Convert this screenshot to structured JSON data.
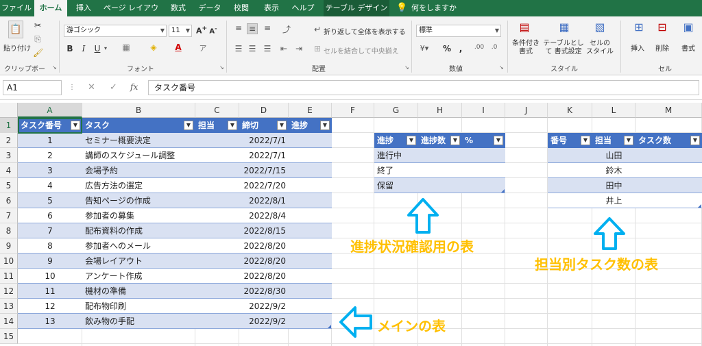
{
  "tabs": [
    "ファイル",
    "ホーム",
    "挿入",
    "ページ レイアウト",
    "数式",
    "データ",
    "校閲",
    "表示",
    "ヘルプ",
    "テーブル デザイン",
    "何をしますか"
  ],
  "ribbon": {
    "clipboard": {
      "paste": "貼り付け",
      "label": "クリップボード"
    },
    "font": {
      "name": "游ゴシック",
      "size": "11",
      "label": "フォント",
      "bold": "B",
      "italic": "I",
      "underline": "U"
    },
    "align": {
      "wrap": "折り返して全体を表示する",
      "merge": "セルを結合して中央揃え",
      "label": "配置"
    },
    "number": {
      "format": "標準",
      "label": "数値",
      "pct": "%",
      "comma": ","
    },
    "styles": {
      "cond": "条件付き 書式",
      "table": "テーブルとして 書式設定",
      "cell": "セルの スタイル",
      "label": "スタイル"
    },
    "cells": {
      "insert": "挿入",
      "delete": "削除",
      "format": "書式",
      "label": "セル"
    }
  },
  "formula_bar": {
    "namebox": "A1",
    "content": "タスク番号",
    "fx": "fx",
    "cancel": "✕",
    "enter": "✓"
  },
  "columns": [
    "A",
    "B",
    "C",
    "D",
    "E",
    "F",
    "G",
    "H",
    "I",
    "J",
    "K",
    "L",
    "M"
  ],
  "rows": [
    "1",
    "2",
    "3",
    "4",
    "5",
    "6",
    "7",
    "8",
    "9",
    "10",
    "11",
    "12",
    "13",
    "14",
    "15"
  ],
  "main_table": {
    "headers": [
      "タスク番号",
      "タスク",
      "担当",
      "締切",
      "進捗"
    ],
    "rows": [
      [
        "1",
        "セミナー概要決定",
        "",
        "2022/7/1",
        ""
      ],
      [
        "2",
        "講師のスケジュール調整",
        "",
        "2022/7/1",
        ""
      ],
      [
        "3",
        "会場予約",
        "",
        "2022/7/15",
        ""
      ],
      [
        "4",
        "広告方法の選定",
        "",
        "2022/7/20",
        ""
      ],
      [
        "5",
        "告知ページの作成",
        "",
        "2022/8/1",
        ""
      ],
      [
        "6",
        "参加者の募集",
        "",
        "2022/8/4",
        ""
      ],
      [
        "7",
        "配布資料の作成",
        "",
        "2022/8/15",
        ""
      ],
      [
        "8",
        "参加者へのメール",
        "",
        "2022/8/20",
        ""
      ],
      [
        "9",
        "会場レイアウト",
        "",
        "2022/8/20",
        ""
      ],
      [
        "10",
        "アンケート作成",
        "",
        "2022/8/20",
        ""
      ],
      [
        "11",
        "機材の準備",
        "",
        "2022/8/30",
        ""
      ],
      [
        "12",
        "配布物印刷",
        "",
        "2022/9/2",
        ""
      ],
      [
        "13",
        "飲み物の手配",
        "",
        "2022/9/2",
        ""
      ]
    ]
  },
  "progress_table": {
    "headers": [
      "進捗",
      "進捗数",
      "%"
    ],
    "rows": [
      [
        "進行中",
        "",
        ""
      ],
      [
        "終了",
        "",
        ""
      ],
      [
        "保留",
        "",
        ""
      ]
    ]
  },
  "assignee_table": {
    "headers": [
      "番号",
      "担当",
      "タスク数"
    ],
    "rows": [
      [
        "",
        "山田",
        ""
      ],
      [
        "",
        "鈴木",
        ""
      ],
      [
        "",
        "田中",
        ""
      ],
      [
        "",
        "井上",
        ""
      ]
    ]
  },
  "annotations": {
    "progress": "進捗状況確認用の表",
    "assignee": "担当別タスク数の表",
    "main": "メインの表"
  },
  "colors": {
    "excel_green": "#217346",
    "header_blue": "#4472c4",
    "band": "#d9e1f2",
    "annotation": "#ffc000",
    "arrow": "#00b0f0"
  }
}
